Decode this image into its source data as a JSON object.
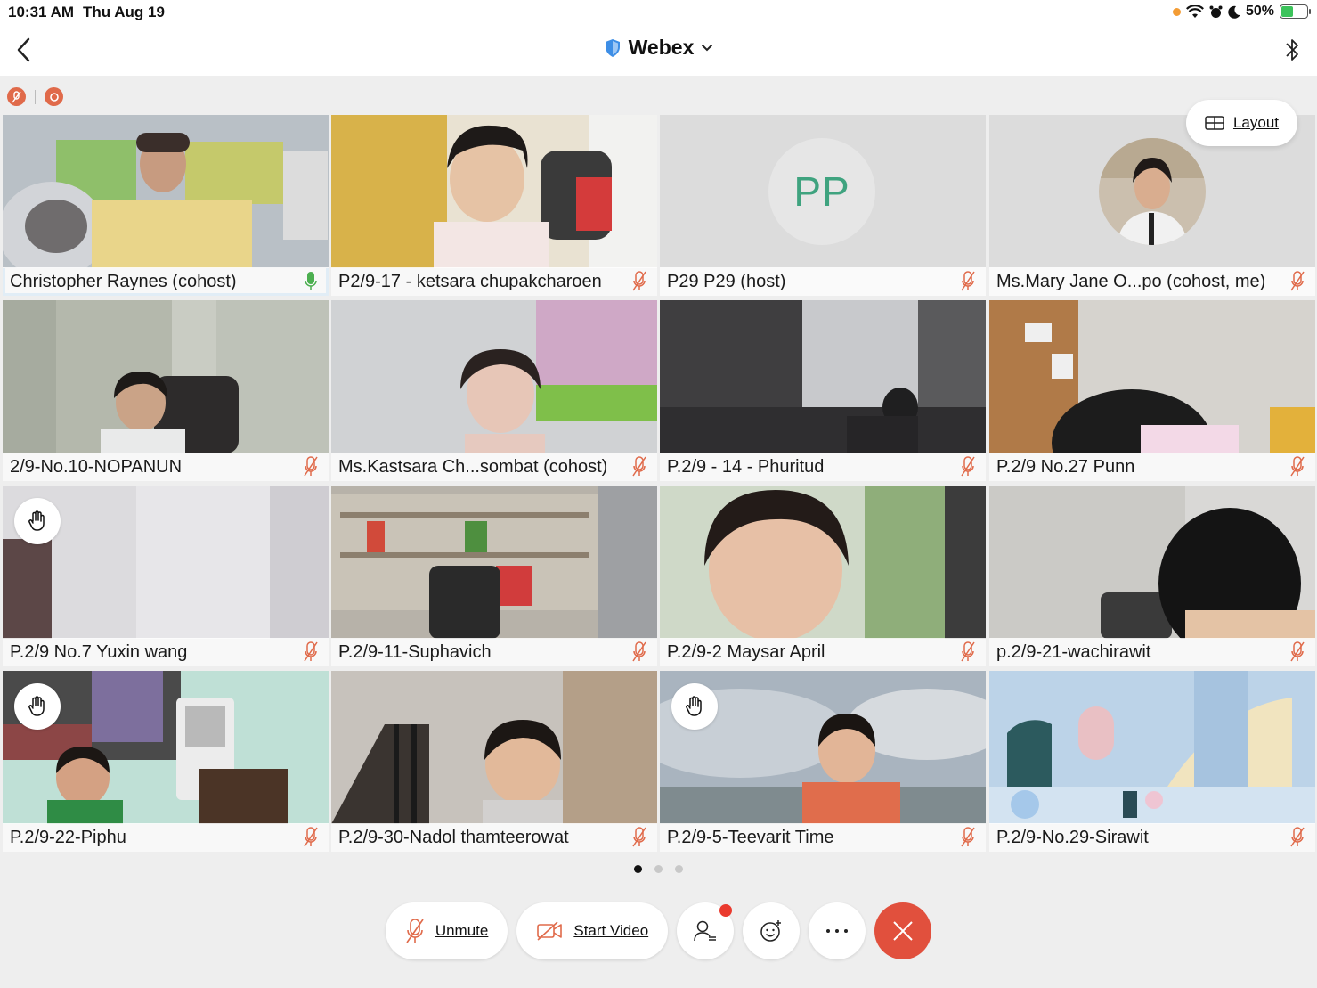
{
  "status_bar": {
    "time": "10:31 AM",
    "date": "Thu Aug 19",
    "battery": "50%",
    "battery_level": 0.5
  },
  "nav": {
    "title": "Webex"
  },
  "layout_button": {
    "label": "Layout"
  },
  "participants": [
    {
      "name": "Christopher Raynes (cohost)",
      "mic": "on",
      "active": true
    },
    {
      "name": "P2/9-17 - ketsara chupakcharoen",
      "mic": "muted"
    },
    {
      "name": "P29 P29 (host)",
      "mic": "muted",
      "initials": "PP"
    },
    {
      "name": "Ms.Mary Jane O...po (cohost, me)",
      "mic": "muted"
    },
    {
      "name": "2/9-No.10-NOPANUN",
      "mic": "muted"
    },
    {
      "name": "Ms.Kastsara Ch...sombat (cohost)",
      "mic": "muted"
    },
    {
      "name": "P.2/9 - 14 - Phuritud",
      "mic": "muted"
    },
    {
      "name": "P.2/9 No.27 Punn",
      "mic": "muted"
    },
    {
      "name": "P.2/9 No.7 Yuxin wang",
      "mic": "muted",
      "hand_raised": true
    },
    {
      "name": "P.2/9-11-Suphavich",
      "mic": "muted"
    },
    {
      "name": "P.2/9-2 Maysar April",
      "mic": "muted"
    },
    {
      "name": "p.2/9-21-wachirawit",
      "mic": "muted"
    },
    {
      "name": "P.2/9-22-Piphu",
      "mic": "muted",
      "hand_raised": true
    },
    {
      "name": "P.2/9-30-Nadol thamteerowat",
      "mic": "muted"
    },
    {
      "name": "P.2/9-5-Teevarit Time",
      "mic": "muted",
      "hand_raised": true
    },
    {
      "name": "P.2/9-No.29-Sirawit",
      "mic": "muted"
    }
  ],
  "pagination": {
    "pages": 3,
    "current": 1
  },
  "controls": {
    "unmute_label": "Unmute",
    "start_video_label": "Start Video",
    "icons": [
      "mic-muted-icon",
      "video-off-icon",
      "participants-icon",
      "reactions-icon",
      "more-icon",
      "end-call-icon"
    ]
  },
  "colors": {
    "accent": "#2f7fc1",
    "mute_red": "#e06a4a",
    "end_call": "#e1503d",
    "notification": "#ea3a2e",
    "initials_green": "#3fa37f",
    "mic_on_green": "#4caf50"
  }
}
